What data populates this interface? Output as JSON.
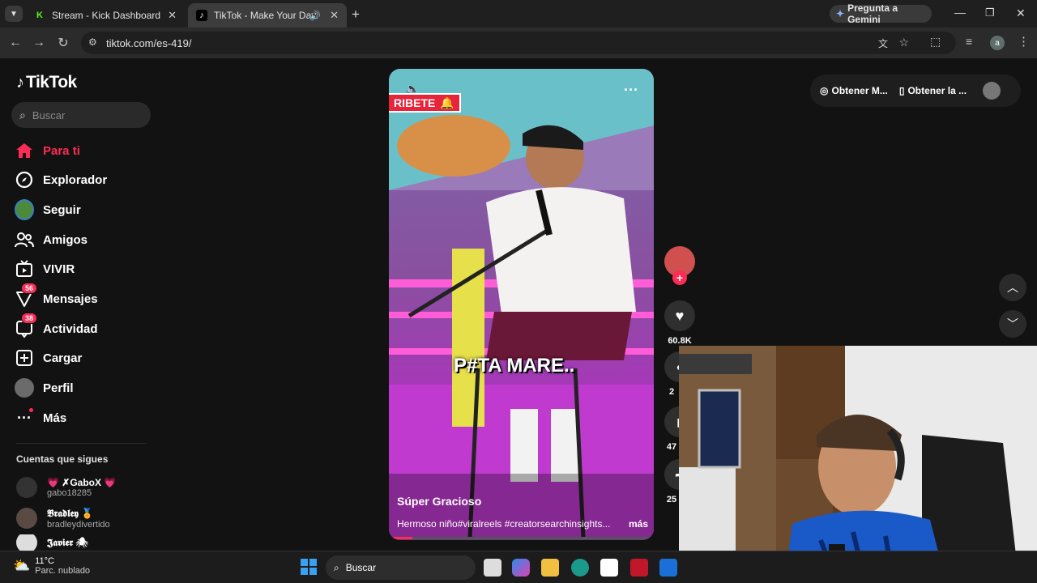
{
  "browser": {
    "tabs": [
      {
        "title": "Stream - Kick Dashboard",
        "favicon": "kick-icon"
      },
      {
        "title": "TikTok - Make Your Day",
        "favicon": "tiktok-icon"
      }
    ],
    "gemini_label": "Pregunta a Gemini",
    "url": "tiktok.com/es-419/",
    "profile_initial": "a"
  },
  "tiktok": {
    "logo": "TikTok",
    "search_placeholder": "Buscar",
    "nav": [
      {
        "label": "Para ti",
        "icon": "home-icon",
        "active": true
      },
      {
        "label": "Explorador",
        "icon": "compass-icon"
      },
      {
        "label": "Seguir",
        "icon": "following-avatar-icon"
      },
      {
        "label": "Amigos",
        "icon": "friends-icon"
      },
      {
        "label": "VIVIR",
        "icon": "live-tv-icon"
      },
      {
        "label": "Mensajes",
        "icon": "messages-icon",
        "badge": "56"
      },
      {
        "label": "Actividad",
        "icon": "activity-icon",
        "badge": "38"
      },
      {
        "label": "Cargar",
        "icon": "upload-icon"
      },
      {
        "label": "Perfil",
        "icon": "profile-avatar-icon"
      },
      {
        "label": "Más",
        "icon": "more-dots-icon"
      }
    ],
    "following_title": "Cuentas que sigues",
    "following": [
      {
        "name": "💗 ✗GaboX 💗",
        "handle": "gabo18285"
      },
      {
        "name": "𝕭𝖗𝖆𝖉𝖑𝖊𝖞 🏅",
        "handle": "bradleydivertido"
      },
      {
        "name": "𝕵𝖆𝖛𝖎𝖊𝖗 🕷",
        "handle": ""
      }
    ],
    "top_right": {
      "btn1": "Obtener M...",
      "btn2": "Obtener la ..."
    },
    "video": {
      "banner": "RIBETE",
      "caption_overlay": "P#TA MARE..",
      "author": "Súper Gracioso",
      "description": "Hermoso niño#viralreels #creatorsearchinsights...",
      "more": "más",
      "likes": "60.8K",
      "count2": "2",
      "count3": "47",
      "count4": "25"
    }
  },
  "taskbar": {
    "temp": "11°C",
    "weather": "Parc. nublado",
    "search": "Buscar"
  },
  "colors": {
    "accent": "#fe2c55",
    "bg": "#121212"
  }
}
